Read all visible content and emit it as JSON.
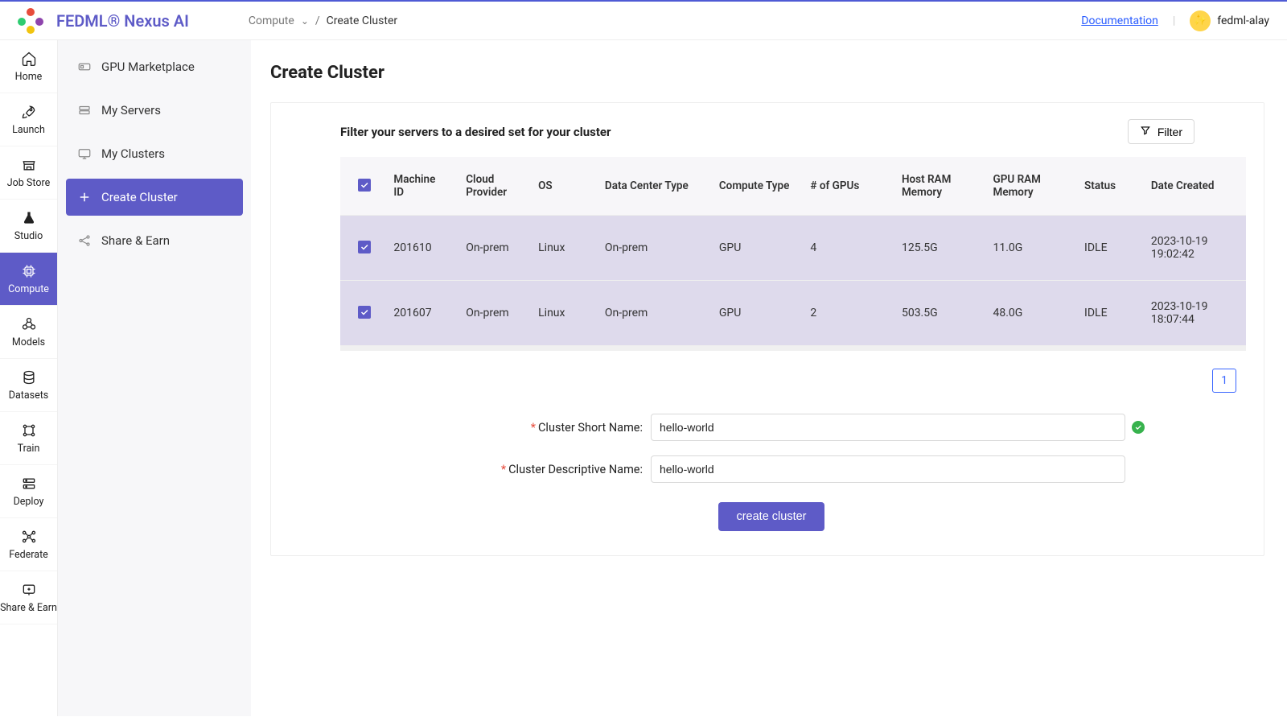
{
  "brand": {
    "name": "FEDML® Nexus AI"
  },
  "breadcrumb": {
    "root": "Compute",
    "sep": "/",
    "current": "Create Cluster",
    "chevron": "⌄"
  },
  "header": {
    "doc": "Documentation",
    "user": "fedml-alay"
  },
  "nav1": {
    "items": [
      {
        "label": "Home"
      },
      {
        "label": "Launch"
      },
      {
        "label": "Job Store"
      },
      {
        "label": "Studio"
      },
      {
        "label": "Compute"
      },
      {
        "label": "Models"
      },
      {
        "label": "Datasets"
      },
      {
        "label": "Train"
      },
      {
        "label": "Deploy"
      },
      {
        "label": "Federate"
      },
      {
        "label": "Share & Earn"
      }
    ]
  },
  "nav2": {
    "items": [
      {
        "label": "GPU Marketplace"
      },
      {
        "label": "My Servers"
      },
      {
        "label": "My Clusters"
      },
      {
        "label": "Create Cluster"
      },
      {
        "label": "Share & Earn"
      }
    ]
  },
  "page": {
    "title": "Create Cluster"
  },
  "card": {
    "filter_title": "Filter your servers to a desired set for your cluster",
    "filter_button": "Filter"
  },
  "table": {
    "headers": {
      "machine_id": "Machine ID",
      "cloud_provider": "Cloud Provider",
      "os": "OS",
      "data_center_type": "Data Center Type",
      "compute_type": "Compute Type",
      "gpus": "# of GPUs",
      "host_ram": "Host RAM Memory",
      "gpu_ram": "GPU RAM Memory",
      "status": "Status",
      "date": "Date Created"
    },
    "rows": [
      {
        "machine_id": "201610",
        "cloud_provider": "On-prem",
        "os": "Linux",
        "dc_type": "On-prem",
        "compute_type": "GPU",
        "gpus": "4",
        "host_ram": "125.5G",
        "gpu_ram": "11.0G",
        "status": "IDLE",
        "date": "2023-10-19 19:02:42"
      },
      {
        "machine_id": "201607",
        "cloud_provider": "On-prem",
        "os": "Linux",
        "dc_type": "On-prem",
        "compute_type": "GPU",
        "gpus": "2",
        "host_ram": "503.5G",
        "gpu_ram": "48.0G",
        "status": "IDLE",
        "date": "2023-10-19 18:07:44"
      }
    ]
  },
  "pager": {
    "page": "1"
  },
  "form": {
    "short_label": "Cluster Short Name",
    "desc_label": "Cluster Descriptive Name",
    "colon": ":",
    "short_value": "hello-world",
    "desc_value": "hello-world",
    "submit": "create cluster"
  }
}
